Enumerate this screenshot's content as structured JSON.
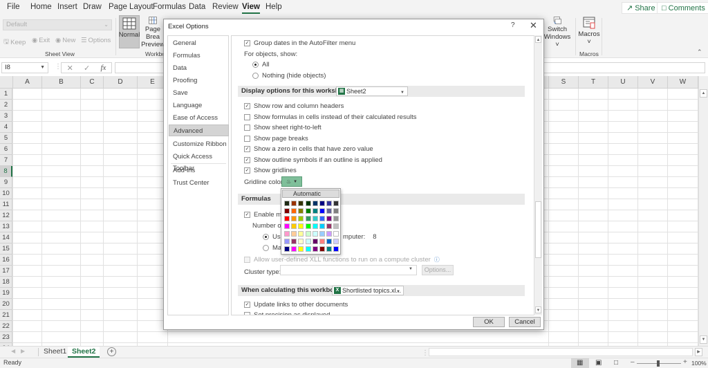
{
  "menu": {
    "tabs": [
      "File",
      "Home",
      "Insert",
      "Draw",
      "Page Layout",
      "Formulas",
      "Data",
      "Review",
      "View",
      "Help"
    ],
    "active_tab": "View",
    "share": "Share",
    "comments": "Comments"
  },
  "ribbon": {
    "sheet_view_select": "Default",
    "keep": "Keep",
    "exit": "Exit",
    "new": "New",
    "options": "Options",
    "sheet_view_label": "Sheet View",
    "normal": "Normal",
    "page_break_line1": "Page Brea",
    "page_break_line2": "Preview",
    "workbook_label": "Workboo",
    "switch_line1": "Switch",
    "switch_line2": "Windows ˅",
    "macros": "Macros",
    "macros_chev": "˅",
    "macros_label": "Macros"
  },
  "formula_bar": {
    "name_box": "I8",
    "fx": "fx",
    "value": ""
  },
  "grid": {
    "columns_left": [
      "A",
      "B",
      "C",
      "D",
      "E"
    ],
    "columns_right": [
      "S",
      "T",
      "U",
      "V",
      "W"
    ],
    "rows": [
      "1",
      "2",
      "3",
      "4",
      "5",
      "6",
      "7",
      "8",
      "9",
      "10",
      "11",
      "12",
      "13",
      "14",
      "15",
      "16",
      "17",
      "18",
      "19",
      "20",
      "21",
      "22",
      "23",
      "24"
    ],
    "selected_row": "8"
  },
  "sheets": {
    "tabs": [
      "Sheet1",
      "Sheet2"
    ],
    "active": "Sheet2"
  },
  "status": {
    "text": "Ready",
    "zoom": "100%",
    "zoom_minus": "–",
    "zoom_plus": "+"
  },
  "dialog": {
    "title": "Excel Options",
    "help": "?",
    "close": "✕",
    "nav": [
      "General",
      "Formulas",
      "Data",
      "Proofing",
      "Save",
      "Language",
      "Ease of Access",
      "Advanced",
      "Customize Ribbon",
      "Quick Access Toolbar",
      "Add-ins",
      "Trust Center"
    ],
    "active_nav": "Advanced",
    "options": {
      "group_dates": {
        "label": "Group dates in the AutoFilter menu",
        "checked": true
      },
      "for_objects_label": "For objects, show:",
      "radio_all": {
        "label": "All",
        "checked": true
      },
      "radio_nothing": {
        "label": "Nothing (hide objects)",
        "checked": false
      },
      "display_section": "Display options for this worksheet:",
      "display_sheet": "Sheet2",
      "show_headers": {
        "label": "Show row and column headers",
        "checked": true
      },
      "show_formulas": {
        "label": "Show formulas in cells instead of their calculated results",
        "checked": false
      },
      "show_rtl": {
        "label": "Show sheet right-to-left",
        "checked": false
      },
      "show_page_breaks": {
        "label": "Show page breaks",
        "checked": false
      },
      "show_zero": {
        "label": "Show a zero in cells that have zero value",
        "checked": true
      },
      "show_outline": {
        "label": "Show outline symbols if an outline is applied",
        "checked": true
      },
      "show_gridlines": {
        "label": "Show gridlines",
        "checked": true
      },
      "gridline_color_label": "Gridline color",
      "formulas_section": "Formulas",
      "enable_multi": {
        "label": "Enable mult",
        "checked": true
      },
      "number_of_label": "Number of c",
      "use_radio": {
        "label": "Use",
        "suffix": "mputer:",
        "value": "8",
        "checked": true
      },
      "manual_radio": {
        "label": "Ma",
        "checked": false
      },
      "allow_xll": {
        "label": "Allow user-defined XLL functions to run on a compute cluster",
        "checked": false
      },
      "cluster_type_label": "Cluster type:",
      "cluster_type_value": "",
      "cluster_options": "Options...",
      "calc_section": "When calculating this workbook:",
      "calc_workbook": "Shortlisted topics.xl...",
      "update_links": {
        "label": "Update links to other documents",
        "checked": true
      },
      "set_precision": {
        "label": "Set precision as displayed",
        "checked": false
      }
    },
    "ok": "OK",
    "cancel": "Cancel"
  },
  "palette": {
    "automatic": "Automatic",
    "colors": [
      [
        "#1f2a14",
        "#993300",
        "#333300",
        "#003300",
        "#003366",
        "#000080",
        "#333399",
        "#333333"
      ],
      [
        "#800000",
        "#ff6600",
        "#808000",
        "#008000",
        "#008080",
        "#0000ff",
        "#666699",
        "#808080"
      ],
      [
        "#ff0000",
        "#ff9900",
        "#99cc00",
        "#339966",
        "#33cccc",
        "#3366ff",
        "#800080",
        "#969696"
      ],
      [
        "#ff00ff",
        "#ffcc00",
        "#ffff00",
        "#00ff00",
        "#00ffff",
        "#00ccff",
        "#993366",
        "#c0c0c0"
      ],
      [
        "#ff99cc",
        "#ffcc99",
        "#ffff99",
        "#ccffcc",
        "#ccffff",
        "#99ccff",
        "#cc99ff",
        "#ffffff"
      ],
      [
        "#9999ff",
        "#993366",
        "#ffffcc",
        "#ccffff",
        "#660066",
        "#ff8080",
        "#0066cc",
        "#ccccff"
      ],
      [
        "#000080",
        "#ff00ff",
        "#ffff00",
        "#00ffff",
        "#800080",
        "#800000",
        "#008080",
        "#0000ff"
      ]
    ]
  }
}
